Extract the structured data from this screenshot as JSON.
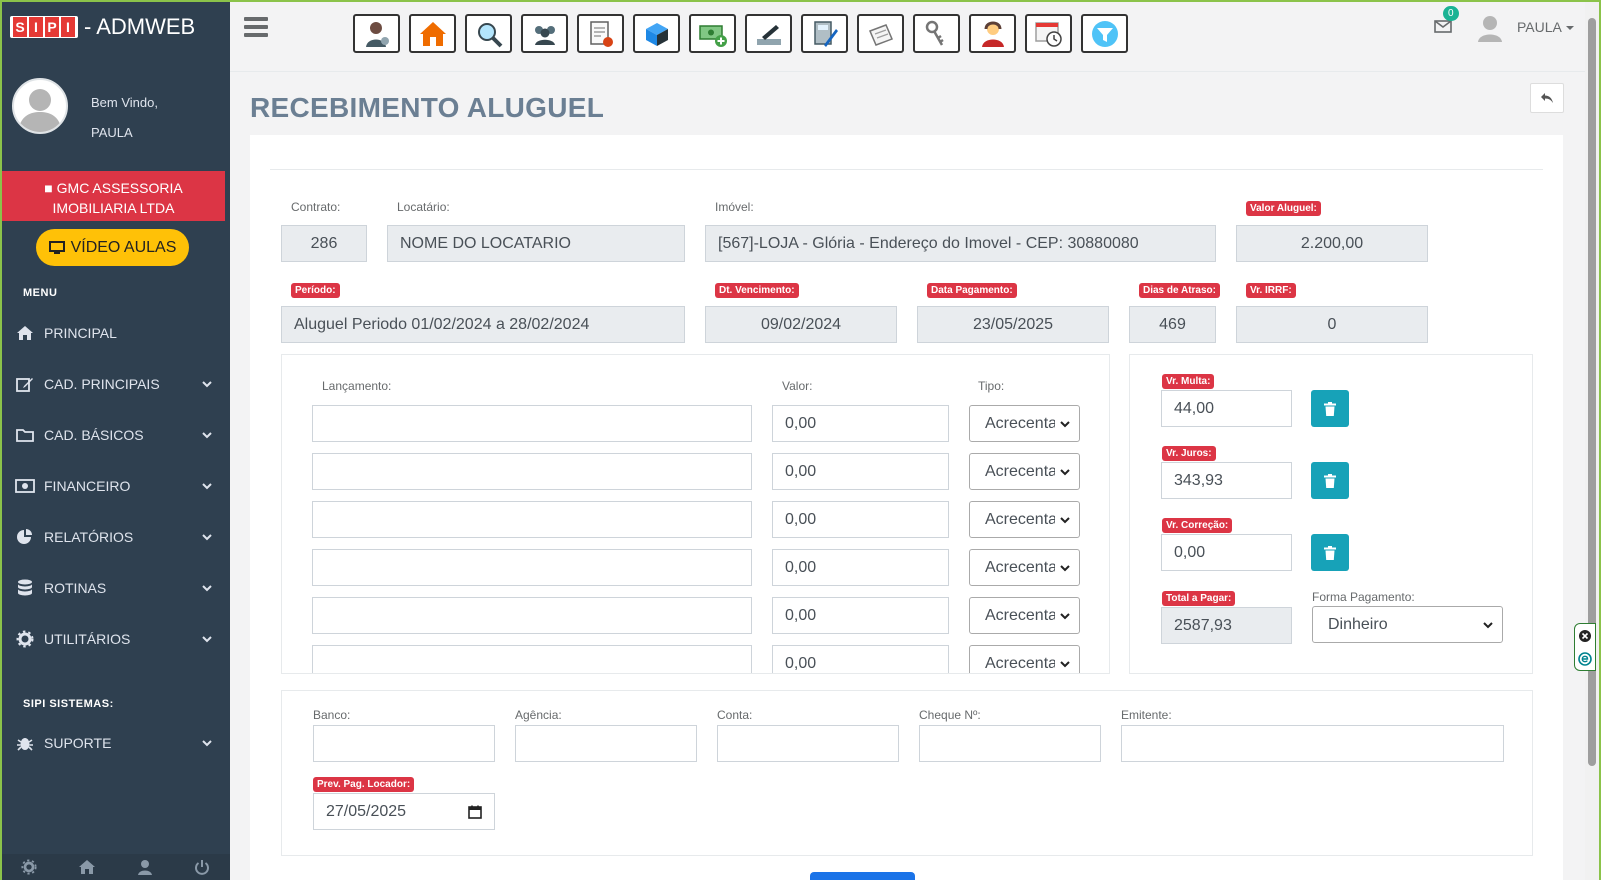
{
  "app": {
    "brand_letters": [
      "S",
      "I",
      "P",
      "I"
    ],
    "brand_name": "- ADMWEB"
  },
  "user": {
    "welcome": "Bem Vindo,",
    "name": "PAULA",
    "top_name": "PAULA",
    "mail_count": "0"
  },
  "company": {
    "line1": "GMC ASSESSORIA",
    "line2": "IMOBILIARIA LTDA"
  },
  "video_button": "VÍDEO AULAS",
  "sidebar": {
    "menu_header": "MENU",
    "items": [
      {
        "label": "PRINCIPAL",
        "icon": "home-icon"
      },
      {
        "label": "CAD. PRINCIPAIS",
        "icon": "edit-icon"
      },
      {
        "label": "CAD. BÁSICOS",
        "icon": "folder-icon"
      },
      {
        "label": "FINANCEIRO",
        "icon": "money-icon"
      },
      {
        "label": "RELATÓRIOS",
        "icon": "pie-chart-icon"
      },
      {
        "label": "ROTINAS",
        "icon": "database-icon"
      },
      {
        "label": "UTILITÁRIOS",
        "icon": "gear-icon"
      }
    ],
    "system_header": "SIPI SISTEMAS:",
    "support": {
      "label": "SUPORTE",
      "icon": "bug-icon"
    }
  },
  "page": {
    "title": "RECEBIMENTO ALUGUEL"
  },
  "form": {
    "contrato": {
      "label": "Contrato:",
      "value": "286"
    },
    "locatario": {
      "label": "Locatário:",
      "value": "NOME DO LOCATARIO"
    },
    "imovel": {
      "label": "Imóvel:",
      "value": "[567]-LOJA - Glória - Endereço do Imovel - CEP: 30880080"
    },
    "valor_aluguel": {
      "label": "Valor Aluguel:",
      "value": "2.200,00"
    },
    "periodo": {
      "label": "Período:",
      "value": "Aluguel Periodo 01/02/2024 a 28/02/2024"
    },
    "dt_vencimento": {
      "label": "Dt. Vencimento:",
      "value": "09/02/2024"
    },
    "data_pagamento": {
      "label": "Data Pagamento:",
      "value": "23/05/2025"
    },
    "dias_atraso": {
      "label": "Dias de Atraso:",
      "value": "469"
    },
    "vr_irrf": {
      "label": "Vr. IRRF:",
      "value": "0"
    }
  },
  "lancamentos": {
    "col_lancamento": "Lançamento:",
    "col_valor": "Valor:",
    "col_tipo": "Tipo:",
    "rows": [
      {
        "descricao": "",
        "valor": "0,00",
        "tipo": "Acrecentar"
      },
      {
        "descricao": "",
        "valor": "0,00",
        "tipo": "Acrecentar"
      },
      {
        "descricao": "",
        "valor": "0,00",
        "tipo": "Acrecentar"
      },
      {
        "descricao": "",
        "valor": "0,00",
        "tipo": "Acrecentar"
      },
      {
        "descricao": "",
        "valor": "0,00",
        "tipo": "Acrecentar"
      },
      {
        "descricao": "",
        "valor": "0,00",
        "tipo": "Acrecentar"
      }
    ]
  },
  "totais": {
    "vr_multa": {
      "label": "Vr. Multa:",
      "value": "44,00"
    },
    "vr_juros": {
      "label": "Vr. Juros:",
      "value": "343,93"
    },
    "vr_correcao": {
      "label": "Vr. Correção:",
      "value": "0,00"
    },
    "total_pagar": {
      "label": "Total a Pagar:",
      "value": "2587,93"
    },
    "forma_pagamento": {
      "label": "Forma Pagamento:",
      "value": "Dinheiro"
    }
  },
  "cheque": {
    "banco": {
      "label": "Banco:",
      "value": ""
    },
    "agencia": {
      "label": "Agência:",
      "value": ""
    },
    "conta": {
      "label": "Conta:",
      "value": ""
    },
    "cheque_no": {
      "label": "Cheque Nº:",
      "value": ""
    },
    "emitente": {
      "label": "Emitente:",
      "value": ""
    },
    "prev_pag_locador": {
      "label": "Prev. Pag. Locador:",
      "value": "27/05/2025"
    }
  },
  "toolbar_icons": [
    "locador-icon",
    "imovel-icon",
    "vistoria-icon",
    "locatarios-icon",
    "contrato-icon",
    "boleto-icon",
    "receber-icon",
    "pagamento-icon",
    "calculadora-icon",
    "documentos-icon",
    "chaves-icon",
    "atendente-icon",
    "agenda-icon",
    "filtro-icon"
  ],
  "colors": {
    "sidebar": "#2f4050",
    "danger": "#dc3545",
    "warning": "#ffc107",
    "info": "#17a2b8",
    "title": "#6b7f93"
  }
}
